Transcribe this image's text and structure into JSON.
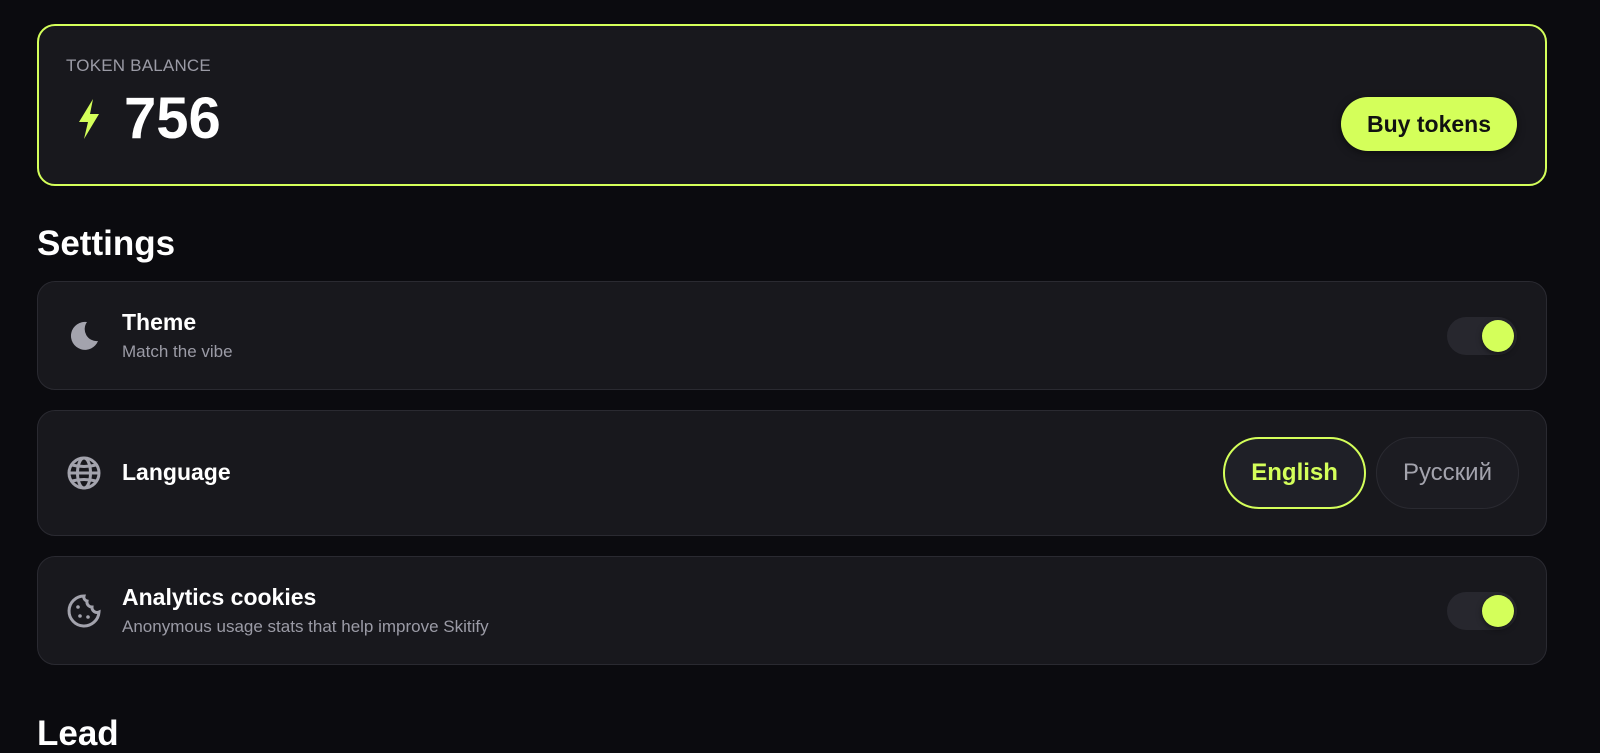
{
  "balance": {
    "label": "TOKEN BALANCE",
    "value": "756",
    "icon": "bolt-icon",
    "buy_label": "Buy tokens"
  },
  "settings": {
    "title": "Settings",
    "theme": {
      "icon": "moon-icon",
      "title": "Theme",
      "subtitle": "Match the vibe",
      "enabled": true
    },
    "language": {
      "icon": "globe-icon",
      "title": "Language",
      "options": [
        "English",
        "Русский"
      ],
      "selected": "English"
    },
    "analytics": {
      "icon": "cookie-icon",
      "title": "Analytics cookies",
      "subtitle": "Anonymous usage stats that help improve Skitify",
      "enabled": true
    }
  },
  "next_section": {
    "title": "Lead"
  },
  "colors": {
    "accent": "#d4ff5a",
    "background": "#0b0b0f",
    "card": "#18181d",
    "muted_text": "#9b9ba6"
  }
}
